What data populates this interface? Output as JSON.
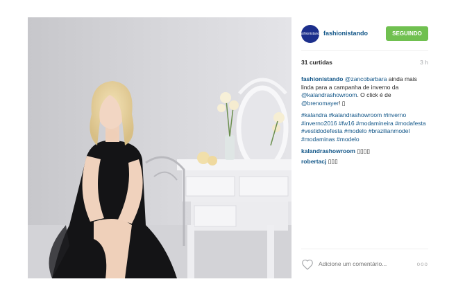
{
  "header": {
    "avatar_text": "fashionistando",
    "username": "fashionistando",
    "follow_label": "SEGUINDO"
  },
  "stats": {
    "likes": "31 curtidas",
    "time": "3 h"
  },
  "caption": {
    "author": "fashionistando",
    "mention1": "@zancobarbara",
    "text1": " ainda mais linda para a campanha de inverno da ",
    "mention2": "@kalandrashowroom",
    "text2": ". O click é de ",
    "mention3": "@brenomayer",
    "text3": "! ▯",
    "hashtags": "#kalandra #kalandrashowroom #inverno #inverno2016 #fw16 #modamineira #modafesta #vestidodefesta #modelo #brazilianmodel #modaminas #modelo"
  },
  "comments": [
    {
      "user": "kalandrashowroom",
      "text": "▯▯▯▯"
    },
    {
      "user": "robertacj",
      "text": "▯▯▯"
    }
  ],
  "footer": {
    "comment_placeholder": "Adicione um comentário...",
    "more_label": "ooo"
  },
  "icons": {
    "heart": "heart-icon",
    "more": "more-options-icon"
  },
  "colors": {
    "link": "#125688",
    "follow_button": "#70c050",
    "muted": "#a5a7aa"
  }
}
